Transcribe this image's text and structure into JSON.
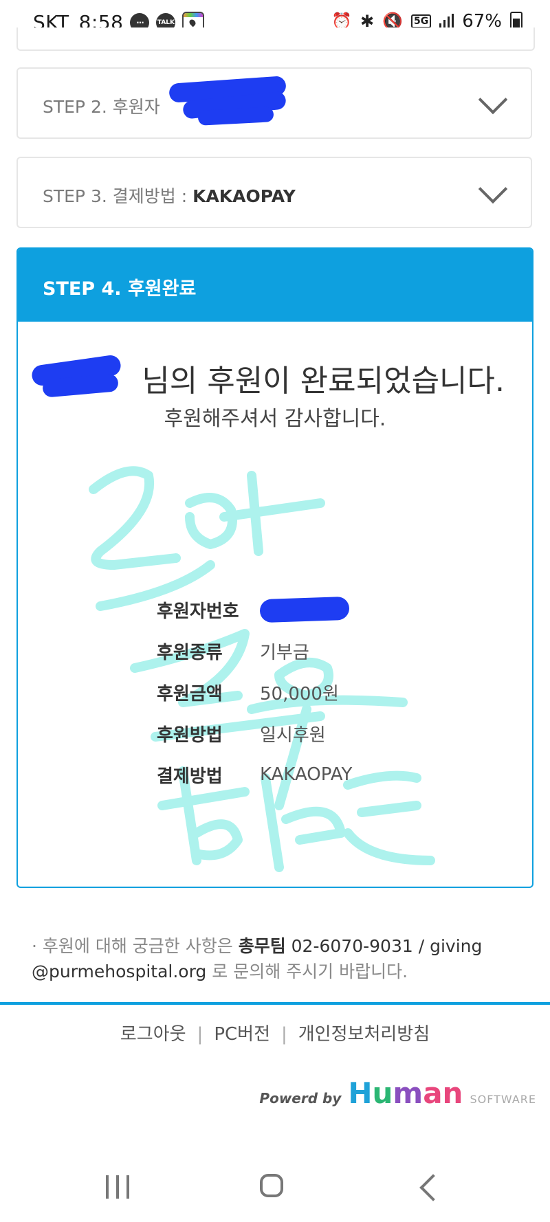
{
  "status_bar": {
    "carrier": "SKT",
    "time": "8:58",
    "app_talk": "TALK",
    "battery": "67%",
    "network": "5G",
    "icons": [
      "chat-icon",
      "talk-icon",
      "map-icon",
      "alarm-icon",
      "bluetooth-icon",
      "mute-icon",
      "5g-icon",
      "signal-icon",
      "battery-icon"
    ]
  },
  "steps": {
    "step2": {
      "label": "STEP 2. 후원자 "
    },
    "step3": {
      "label": "STEP 3. 결제방법 : ",
      "value": "KAKAOPAY"
    }
  },
  "step4": {
    "title": "STEP 4. 후원완료",
    "complete_message": "님의 후원이 완료되었습니다.",
    "thanks_message": "후원해주셔서 감사합니다.",
    "details": [
      {
        "label": "후원자번호",
        "value": ""
      },
      {
        "label": "후원종류",
        "value": "기부금"
      },
      {
        "label": "후원금액",
        "value": "50,000원"
      },
      {
        "label": "후원방법",
        "value": "일시후원"
      },
      {
        "label": "결제방법",
        "value": "KAKAOPAY"
      }
    ]
  },
  "footer": {
    "inquiry_prefix": "· 후원에 대해 궁금한 사항은 ",
    "inquiry_team": "총무팀",
    "inquiry_phone": " 02-6070-9031",
    "inquiry_mid": " / ",
    "inquiry_email": "giving @purmehospital.org",
    "inquiry_suffix": " 로 문의해 주시기 바랍니다.",
    "links": [
      "로그아웃",
      "PC버전",
      "개인정보처리방침"
    ],
    "link_separator": "|",
    "powered_by": "Powerd by",
    "brand": "Human",
    "brand_suffix": "SOFTWARE"
  },
  "colors": {
    "accent": "#0ea0df",
    "redaction": "#1e3df2",
    "handwriting": "#9ff0ea"
  }
}
